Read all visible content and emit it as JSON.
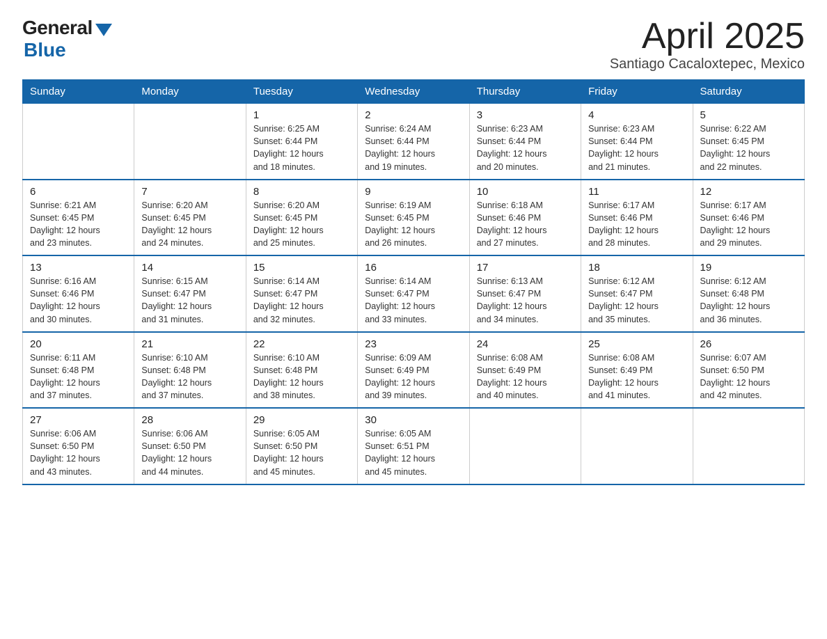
{
  "logo": {
    "general": "General",
    "blue": "Blue"
  },
  "title": "April 2025",
  "subtitle": "Santiago Cacaloxtepec, Mexico",
  "headers": [
    "Sunday",
    "Monday",
    "Tuesday",
    "Wednesday",
    "Thursday",
    "Friday",
    "Saturday"
  ],
  "weeks": [
    [
      {
        "day": "",
        "info": ""
      },
      {
        "day": "",
        "info": ""
      },
      {
        "day": "1",
        "info": "Sunrise: 6:25 AM\nSunset: 6:44 PM\nDaylight: 12 hours\nand 18 minutes."
      },
      {
        "day": "2",
        "info": "Sunrise: 6:24 AM\nSunset: 6:44 PM\nDaylight: 12 hours\nand 19 minutes."
      },
      {
        "day": "3",
        "info": "Sunrise: 6:23 AM\nSunset: 6:44 PM\nDaylight: 12 hours\nand 20 minutes."
      },
      {
        "day": "4",
        "info": "Sunrise: 6:23 AM\nSunset: 6:44 PM\nDaylight: 12 hours\nand 21 minutes."
      },
      {
        "day": "5",
        "info": "Sunrise: 6:22 AM\nSunset: 6:45 PM\nDaylight: 12 hours\nand 22 minutes."
      }
    ],
    [
      {
        "day": "6",
        "info": "Sunrise: 6:21 AM\nSunset: 6:45 PM\nDaylight: 12 hours\nand 23 minutes."
      },
      {
        "day": "7",
        "info": "Sunrise: 6:20 AM\nSunset: 6:45 PM\nDaylight: 12 hours\nand 24 minutes."
      },
      {
        "day": "8",
        "info": "Sunrise: 6:20 AM\nSunset: 6:45 PM\nDaylight: 12 hours\nand 25 minutes."
      },
      {
        "day": "9",
        "info": "Sunrise: 6:19 AM\nSunset: 6:45 PM\nDaylight: 12 hours\nand 26 minutes."
      },
      {
        "day": "10",
        "info": "Sunrise: 6:18 AM\nSunset: 6:46 PM\nDaylight: 12 hours\nand 27 minutes."
      },
      {
        "day": "11",
        "info": "Sunrise: 6:17 AM\nSunset: 6:46 PM\nDaylight: 12 hours\nand 28 minutes."
      },
      {
        "day": "12",
        "info": "Sunrise: 6:17 AM\nSunset: 6:46 PM\nDaylight: 12 hours\nand 29 minutes."
      }
    ],
    [
      {
        "day": "13",
        "info": "Sunrise: 6:16 AM\nSunset: 6:46 PM\nDaylight: 12 hours\nand 30 minutes."
      },
      {
        "day": "14",
        "info": "Sunrise: 6:15 AM\nSunset: 6:47 PM\nDaylight: 12 hours\nand 31 minutes."
      },
      {
        "day": "15",
        "info": "Sunrise: 6:14 AM\nSunset: 6:47 PM\nDaylight: 12 hours\nand 32 minutes."
      },
      {
        "day": "16",
        "info": "Sunrise: 6:14 AM\nSunset: 6:47 PM\nDaylight: 12 hours\nand 33 minutes."
      },
      {
        "day": "17",
        "info": "Sunrise: 6:13 AM\nSunset: 6:47 PM\nDaylight: 12 hours\nand 34 minutes."
      },
      {
        "day": "18",
        "info": "Sunrise: 6:12 AM\nSunset: 6:47 PM\nDaylight: 12 hours\nand 35 minutes."
      },
      {
        "day": "19",
        "info": "Sunrise: 6:12 AM\nSunset: 6:48 PM\nDaylight: 12 hours\nand 36 minutes."
      }
    ],
    [
      {
        "day": "20",
        "info": "Sunrise: 6:11 AM\nSunset: 6:48 PM\nDaylight: 12 hours\nand 37 minutes."
      },
      {
        "day": "21",
        "info": "Sunrise: 6:10 AM\nSunset: 6:48 PM\nDaylight: 12 hours\nand 37 minutes."
      },
      {
        "day": "22",
        "info": "Sunrise: 6:10 AM\nSunset: 6:48 PM\nDaylight: 12 hours\nand 38 minutes."
      },
      {
        "day": "23",
        "info": "Sunrise: 6:09 AM\nSunset: 6:49 PM\nDaylight: 12 hours\nand 39 minutes."
      },
      {
        "day": "24",
        "info": "Sunrise: 6:08 AM\nSunset: 6:49 PM\nDaylight: 12 hours\nand 40 minutes."
      },
      {
        "day": "25",
        "info": "Sunrise: 6:08 AM\nSunset: 6:49 PM\nDaylight: 12 hours\nand 41 minutes."
      },
      {
        "day": "26",
        "info": "Sunrise: 6:07 AM\nSunset: 6:50 PM\nDaylight: 12 hours\nand 42 minutes."
      }
    ],
    [
      {
        "day": "27",
        "info": "Sunrise: 6:06 AM\nSunset: 6:50 PM\nDaylight: 12 hours\nand 43 minutes."
      },
      {
        "day": "28",
        "info": "Sunrise: 6:06 AM\nSunset: 6:50 PM\nDaylight: 12 hours\nand 44 minutes."
      },
      {
        "day": "29",
        "info": "Sunrise: 6:05 AM\nSunset: 6:50 PM\nDaylight: 12 hours\nand 45 minutes."
      },
      {
        "day": "30",
        "info": "Sunrise: 6:05 AM\nSunset: 6:51 PM\nDaylight: 12 hours\nand 45 minutes."
      },
      {
        "day": "",
        "info": ""
      },
      {
        "day": "",
        "info": ""
      },
      {
        "day": "",
        "info": ""
      }
    ]
  ]
}
